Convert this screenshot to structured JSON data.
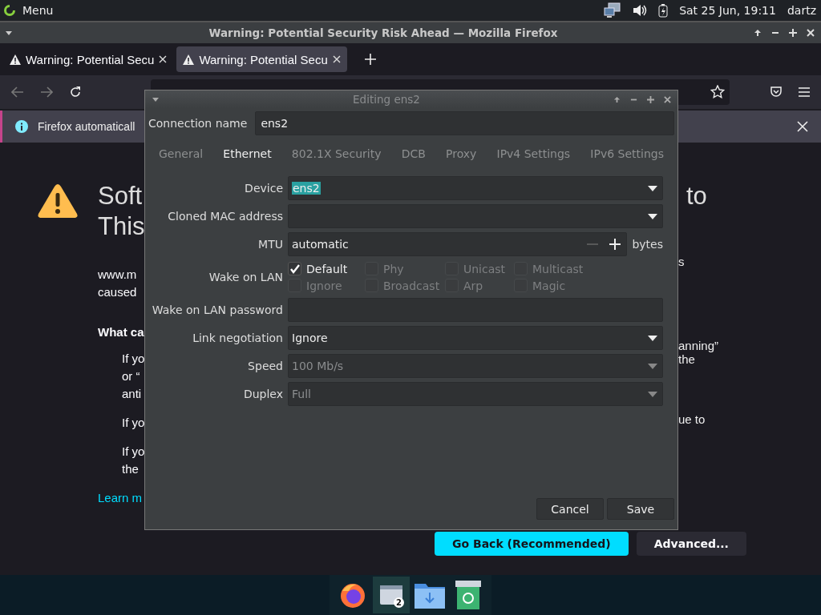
{
  "top_panel": {
    "menu": "Menu",
    "clock": "Sat 25 Jun, 19:11",
    "user": "dartz"
  },
  "window": {
    "title": "Warning: Potential Security Risk Ahead — Mozilla Firefox"
  },
  "tabs": [
    {
      "label": "Warning: Potential Secu",
      "selected": false
    },
    {
      "label": "Warning: Potential Secu",
      "selected": true
    }
  ],
  "notification": {
    "text": "Firefox automaticall"
  },
  "page": {
    "left_lines": [
      {
        "kind": "heading",
        "text": "Soft"
      },
      {
        "kind": "heading",
        "text": "This"
      },
      {
        "kind": "para",
        "text": "www.m"
      },
      {
        "kind": "para",
        "text": "caused"
      },
      {
        "kind": "bold",
        "text": "What ca"
      },
      {
        "kind": "bullet",
        "text": "If yo"
      },
      {
        "kind": "cont",
        "text": "or “"
      },
      {
        "kind": "cont",
        "text": "anti"
      },
      {
        "kind": "bullet",
        "text": "If yo"
      },
      {
        "kind": "bullet",
        "text": "If yo"
      },
      {
        "kind": "cont",
        "text": "the"
      },
      {
        "kind": "link",
        "text": "Learn m"
      }
    ],
    "right_lines": [
      {
        "kind": "heading",
        "text": "to"
      },
      {
        "kind": "para",
        "text": "s"
      },
      {
        "kind": "para",
        "text": "anning”"
      },
      {
        "kind": "para",
        "text": "the"
      },
      {
        "kind": "para",
        "text": "ue to"
      }
    ],
    "buttons": [
      {
        "kind": "primary",
        "label": "Go Back (Recommended)"
      },
      {
        "kind": "secondary",
        "label": "Advanced..."
      }
    ]
  },
  "dialog": {
    "title": "Editing ens2",
    "connection_label": "Connection name",
    "connection_name": "ens2",
    "tabs": [
      {
        "label": "General",
        "selected": false
      },
      {
        "label": "Ethernet",
        "selected": true
      },
      {
        "label": "802.1X Security",
        "selected": false
      },
      {
        "label": "DCB",
        "selected": false
      },
      {
        "label": "Proxy",
        "selected": false
      },
      {
        "label": "IPv4 Settings",
        "selected": false
      },
      {
        "label": "IPv6 Settings",
        "selected": false
      }
    ],
    "device": {
      "label": "Device",
      "value": "ens2"
    },
    "cloned_mac": {
      "label": "Cloned MAC address"
    },
    "mtu": {
      "label": "MTU",
      "value": "automatic",
      "unit": "bytes"
    },
    "wake_on_lan": {
      "label": "Wake on LAN",
      "options": [
        {
          "label": "Default",
          "checked": true,
          "disabled": false
        },
        {
          "label": "Phy",
          "checked": false,
          "disabled": true
        },
        {
          "label": "Unicast",
          "checked": false,
          "disabled": true
        },
        {
          "label": "Multicast",
          "checked": false,
          "disabled": true
        },
        {
          "label": "Ignore",
          "checked": false,
          "disabled": true
        },
        {
          "label": "Broadcast",
          "checked": false,
          "disabled": true
        },
        {
          "label": "Arp",
          "checked": false,
          "disabled": true
        },
        {
          "label": "Magic",
          "checked": false,
          "disabled": true
        }
      ]
    },
    "wol_password": {
      "label": "Wake on LAN password"
    },
    "combos": [
      {
        "label": "Link negotiation",
        "value": "Ignore",
        "disabled": false
      },
      {
        "label": "Speed",
        "value": "100 Mb/s",
        "disabled": true
      },
      {
        "label": "Duplex",
        "value": "Full",
        "disabled": true
      }
    ],
    "buttons": [
      "Cancel",
      "Save"
    ]
  },
  "dock": [
    {
      "kind": "firefox"
    },
    {
      "kind": "windows",
      "badge": "2",
      "selected": true
    },
    {
      "kind": "folder",
      "selected": false
    },
    {
      "kind": "trash",
      "selected": false
    }
  ]
}
